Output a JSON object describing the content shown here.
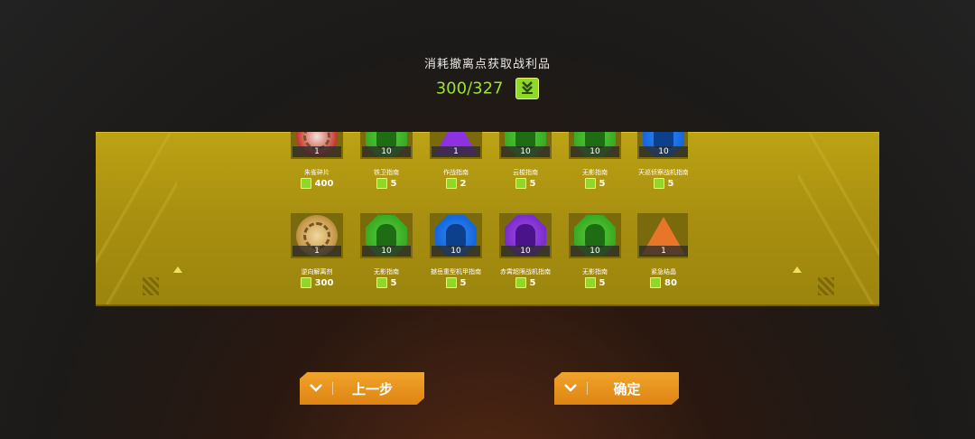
{
  "header": {
    "title": "消耗撤离点获取战利品",
    "counter": "300/327"
  },
  "row1": [
    {
      "qty": "1",
      "name": "朱雀碎片",
      "price": "400",
      "icon": "phoenix-emblem",
      "kind": "round-red"
    },
    {
      "qty": "10",
      "name": "铁卫指南",
      "price": "5",
      "icon": "mech-green",
      "kind": "green"
    },
    {
      "qty": "1",
      "name": "作战指南",
      "price": "2",
      "icon": "triangle-purple",
      "kind": "tri-purple"
    },
    {
      "qty": "10",
      "name": "云梭指南",
      "price": "5",
      "icon": "mech-green",
      "kind": "green"
    },
    {
      "qty": "10",
      "name": "无影指南",
      "price": "5",
      "icon": "mech-green",
      "kind": "green"
    },
    {
      "qty": "10",
      "name": "天巡侦察战机指南",
      "price": "5",
      "icon": "mech-blue",
      "kind": "blue"
    }
  ],
  "row2": [
    {
      "qty": "1",
      "name": "逆向解离剂",
      "price": "300",
      "icon": "gear-medallion",
      "kind": "round"
    },
    {
      "qty": "10",
      "name": "无影指南",
      "price": "5",
      "icon": "mech-green",
      "kind": "green"
    },
    {
      "qty": "10",
      "name": "撼岳重型机甲指南",
      "price": "5",
      "icon": "mech-blue",
      "kind": "blue"
    },
    {
      "qty": "10",
      "name": "赤霄超限战机指南",
      "price": "5",
      "icon": "jet-purple",
      "kind": "purple"
    },
    {
      "qty": "10",
      "name": "无影指南",
      "price": "5",
      "icon": "mech-green",
      "kind": "green"
    },
    {
      "qty": "1",
      "name": "紧急结晶",
      "price": "80",
      "icon": "triangle-orange",
      "kind": "tri-orange"
    }
  ],
  "buttons": {
    "prev_label": "上一步",
    "confirm_label": "确定"
  },
  "colors": {
    "accent_green": "#9be32f",
    "panel_gold": "#bca214",
    "button_orange": "#f0a42a"
  }
}
